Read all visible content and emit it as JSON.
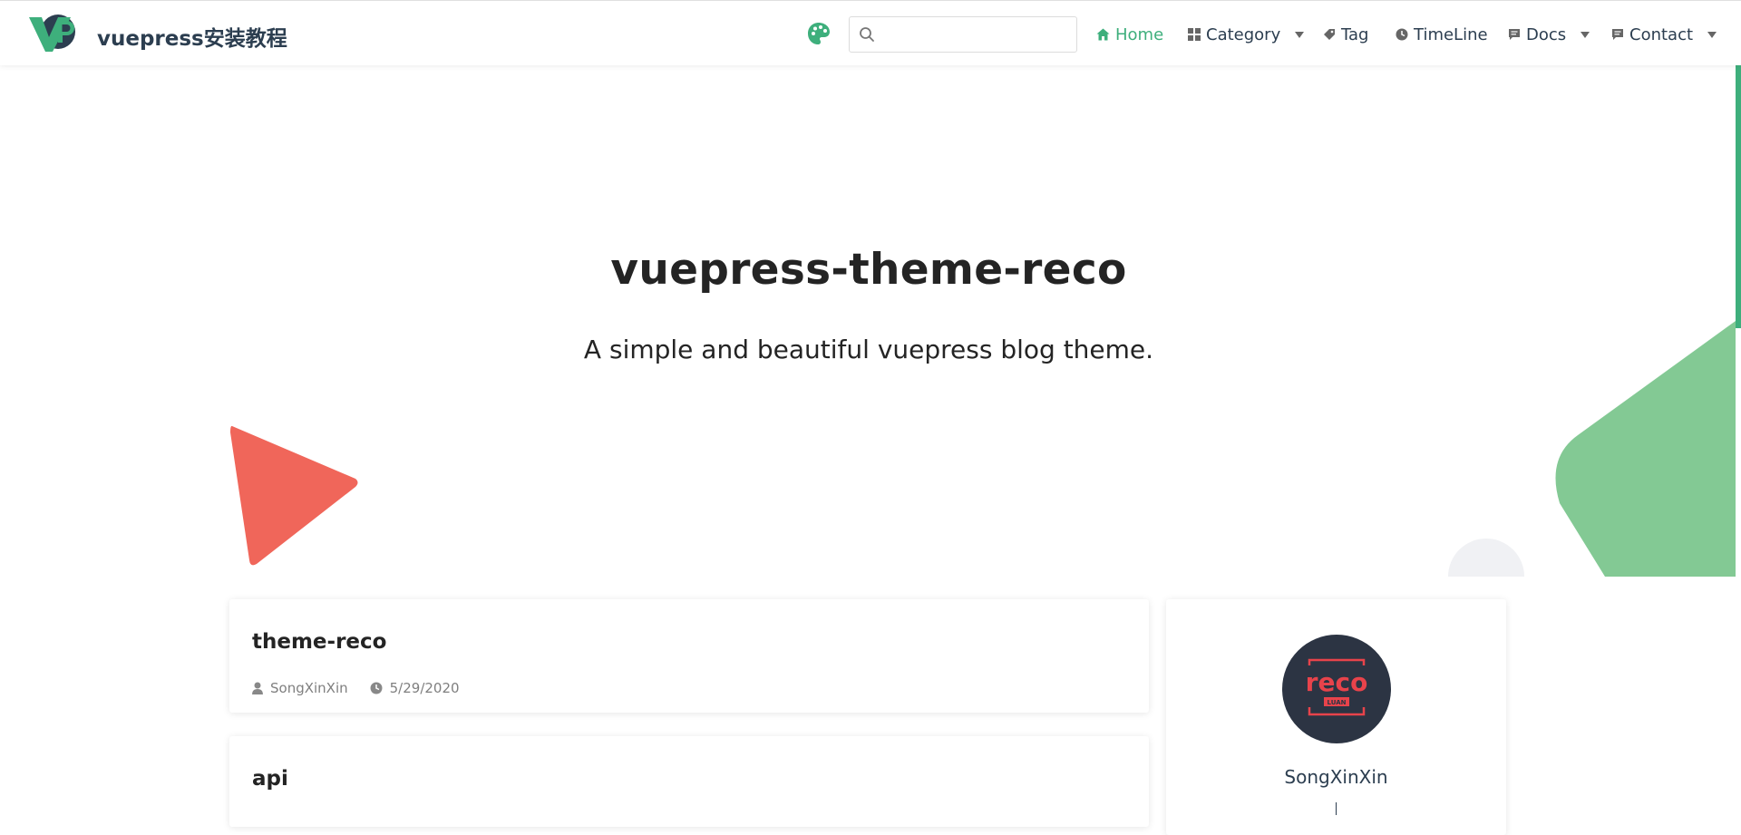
{
  "navbar": {
    "site_name": "vuepress安装教程",
    "search": {
      "placeholder": "",
      "value": ""
    },
    "items": [
      {
        "label": "Home",
        "icon": "home-icon",
        "active": true
      },
      {
        "label": "Category",
        "icon": "category-icon",
        "dropdown": true
      },
      {
        "label": "Tag",
        "icon": "tag-icon"
      },
      {
        "label": "TimeLine",
        "icon": "clock-icon"
      },
      {
        "label": "Docs",
        "icon": "message-icon",
        "dropdown": true
      },
      {
        "label": "Contact",
        "icon": "message-icon",
        "dropdown": true
      }
    ]
  },
  "hero": {
    "title": "vuepress-theme-reco",
    "subtitle": "A simple and beautiful vuepress blog theme."
  },
  "posts": [
    {
      "title": "theme-reco",
      "author": "SongXinXin",
      "date": "5/29/2020"
    },
    {
      "title": "api"
    }
  ],
  "profile": {
    "name": "SongXinXin",
    "avatar_text": "reco",
    "avatar_badge": "LUAN"
  },
  "colors": {
    "accent": "#3eaf7c",
    "triangle": "#f0665a",
    "green_shape": "#83c994",
    "text": "#2c3e50",
    "avatar_bg": "#2c3443"
  }
}
